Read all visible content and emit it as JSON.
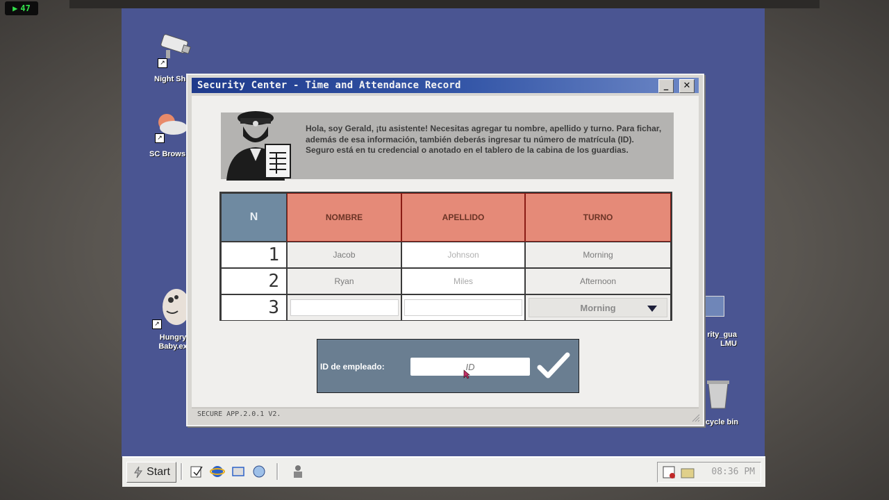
{
  "overlay": {
    "fps": "47"
  },
  "desktop": {
    "icons": [
      {
        "label": "Night Sh"
      },
      {
        "label": "SC Brows"
      },
      {
        "label": "Hungry\nBaby.ex"
      },
      {
        "label": "rity_gua\nLMU"
      },
      {
        "label": "recycle bin"
      }
    ]
  },
  "window": {
    "title": "Security Center - Time and Attendance Record",
    "minimize": "_",
    "close": "✕",
    "assistant_message": "Hola, soy Gerald, ¡tu asistente! Necesitas agregar tu nombre, apellido y turno. Para fichar, además de esa información, también deberás ingresar tu número de matrícula (ID). Seguro está en tu credencial o anotado en el tablero de la cabina de los guardias.",
    "table": {
      "headers": [
        "N",
        "NOMBRE",
        "APELLIDO",
        "TURNO"
      ],
      "rows": [
        {
          "n": "1",
          "nombre": "Jacob",
          "apellido": "Johnson",
          "turno": "Morning"
        },
        {
          "n": "2",
          "nombre": "Ryan",
          "apellido": "Miles",
          "turno": "Afternoon"
        }
      ],
      "new_row": {
        "n": "3",
        "nombre": "",
        "apellido": "",
        "turno_selected": "Morning"
      }
    },
    "id_panel": {
      "label": "ID de empleado:",
      "placeholder": "ID",
      "value": ""
    },
    "status": "SECURE APP.2.0.1 V2."
  },
  "taskbar": {
    "start": "Start",
    "clock": "08:36 PM"
  }
}
